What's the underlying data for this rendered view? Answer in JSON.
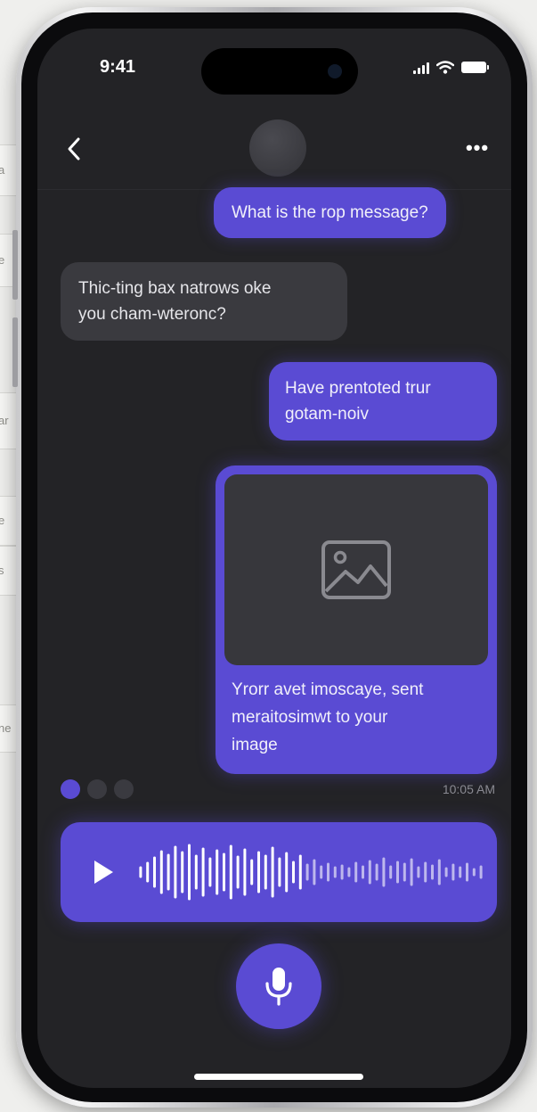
{
  "background_cards": [
    {
      "text": "a"
    },
    {
      "text": "e"
    },
    {
      "text": "ar"
    },
    {
      "text": "e"
    },
    {
      "text": "s"
    },
    {
      "text": "ne"
    }
  ],
  "status_bar": {
    "time": "9:41",
    "icons": [
      "signal-icon",
      "wifi-icon",
      "battery-icon"
    ]
  },
  "header": {
    "back_icon": "chevron-left-icon",
    "more_icon": "more-horizontal-icon",
    "more_label": "•••"
  },
  "messages": [
    {
      "direction": "outgoing",
      "text": "What is the rop message?"
    },
    {
      "direction": "incoming",
      "lines": [
        "Thic-ting bax natrows oke",
        "you cham-wteronc?"
      ]
    },
    {
      "direction": "outgoing",
      "lines": [
        "Have prentoted trur",
        "gotam-noiv"
      ]
    },
    {
      "direction": "outgoing",
      "type": "image",
      "image_icon": "image-icon",
      "caption_lines": [
        "Yrorr avet imoscaye, sent",
        "meraitosimwt to your",
        "image"
      ]
    }
  ],
  "typing_indicator": {
    "dot_colors": [
      "#5a4bd3",
      "#3a3a40",
      "#3a3a40"
    ]
  },
  "timestamp": "10:05 AM",
  "voice_message": {
    "play_icon": "play-icon",
    "waveform_icon": "waveform-icon"
  },
  "mic_button": {
    "icon": "microphone-icon"
  },
  "colors": {
    "accent": "#5a4bd3",
    "screen_background": "#232326",
    "incoming_bubble": "#3a3a3f",
    "page_background": "#efefed"
  }
}
